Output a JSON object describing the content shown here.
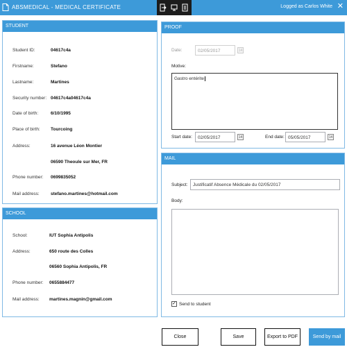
{
  "window": {
    "title": "ABSMEDICAL - MEDICAL CERTIFICATE",
    "logged_in": "Logged as Carlos White",
    "close_glyph": "✕"
  },
  "student": {
    "header": "STUDENT",
    "fields": [
      {
        "label": "Student ID:",
        "value": "04617c4a"
      },
      {
        "label": "Firstname:",
        "value": "Stefano"
      },
      {
        "label": "Lastname:",
        "value": "Martines"
      },
      {
        "label": "Security number:",
        "value": "04617c4a04617c4a"
      },
      {
        "label": "Date of birth:",
        "value": "6/10/1995"
      },
      {
        "label": "Place of birth:",
        "value": "Tourcoing"
      },
      {
        "label": "Address:",
        "value": "16 avenue Léon Montier"
      },
      {
        "label": "",
        "value": "06590 Theoule sur Mer, FR"
      },
      {
        "label": "Phone number:",
        "value": "0699835052"
      },
      {
        "label": "Mail address:",
        "value": "stefano.martines@hotmail.com"
      }
    ]
  },
  "school": {
    "header": "SCHOOL",
    "fields": [
      {
        "label": "School:",
        "value": "IUT Sophia Antipolis"
      },
      {
        "label": "Address:",
        "value": "650 route des Colles"
      },
      {
        "label": "",
        "value": "06560 Sophia Antipolis, FR"
      },
      {
        "label": "Phone number:",
        "value": "0655884477"
      },
      {
        "label": "Mail address:",
        "value": "martines.magnin@gmail.com"
      }
    ]
  },
  "proof": {
    "header": "PROOF",
    "date_label": "Date:",
    "date_value": "02/05/2017",
    "motive_label": "Motive:",
    "motive_value": "Gastro entérite",
    "start_label": "Start date:",
    "start_value": "02/05/2017",
    "end_label": "End date:",
    "end_value": "05/05/2017",
    "calendar_glyph": "14"
  },
  "mail": {
    "header": "MAIL",
    "subject_label": "Subject:",
    "subject_value": "Justificatif Absence Médicale du 02/05/2017",
    "body_label": "Body:",
    "body_value": "",
    "send_to_student_label": "Send to student",
    "send_to_student_checked": true,
    "check_glyph": "✓"
  },
  "actions": {
    "close": "Close",
    "save": "Save",
    "export": "Export to PDF",
    "send": "Send by mail"
  },
  "colors": {
    "accent": "#3d9ad9",
    "panel_border": "#7fb9e4"
  }
}
